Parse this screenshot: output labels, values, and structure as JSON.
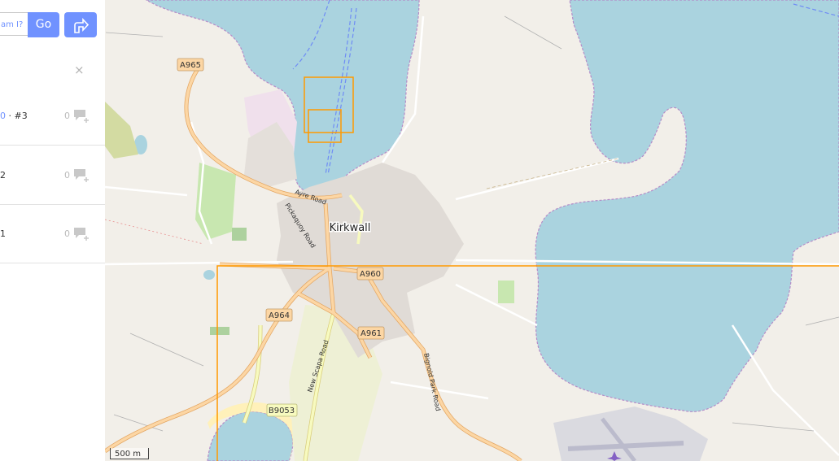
{
  "search": {
    "placeholder": "am I?",
    "go_label": "Go"
  },
  "sidebar": {
    "close_symbol": "×",
    "items": [
      {
        "ref_link": "0",
        "ref_suffix": " · #3",
        "count": "0"
      },
      {
        "ref_link": "",
        "ref_suffix": "2",
        "count": "0"
      },
      {
        "ref_link": "",
        "ref_suffix": "1",
        "count": "0"
      }
    ]
  },
  "map": {
    "town_label": "Kirkwall",
    "road_shields": [
      "A965",
      "A960",
      "A964",
      "A961",
      "B9053"
    ],
    "street_labels": [
      "Ayre Road",
      "Pickaquoy Road",
      "New Scapa Road",
      "Bignold Park Road"
    ],
    "scale_label": "500 m",
    "colors": {
      "water": "#aad3df",
      "land": "#f2efe9",
      "road_primary": "#fcd6a4",
      "road_secondary": "#f7fabf",
      "highlight": "#ff9900",
      "accent": "#7092ff"
    },
    "icons": [
      "directions-icon",
      "comment-icon",
      "close-icon",
      "airport-icon"
    ]
  }
}
